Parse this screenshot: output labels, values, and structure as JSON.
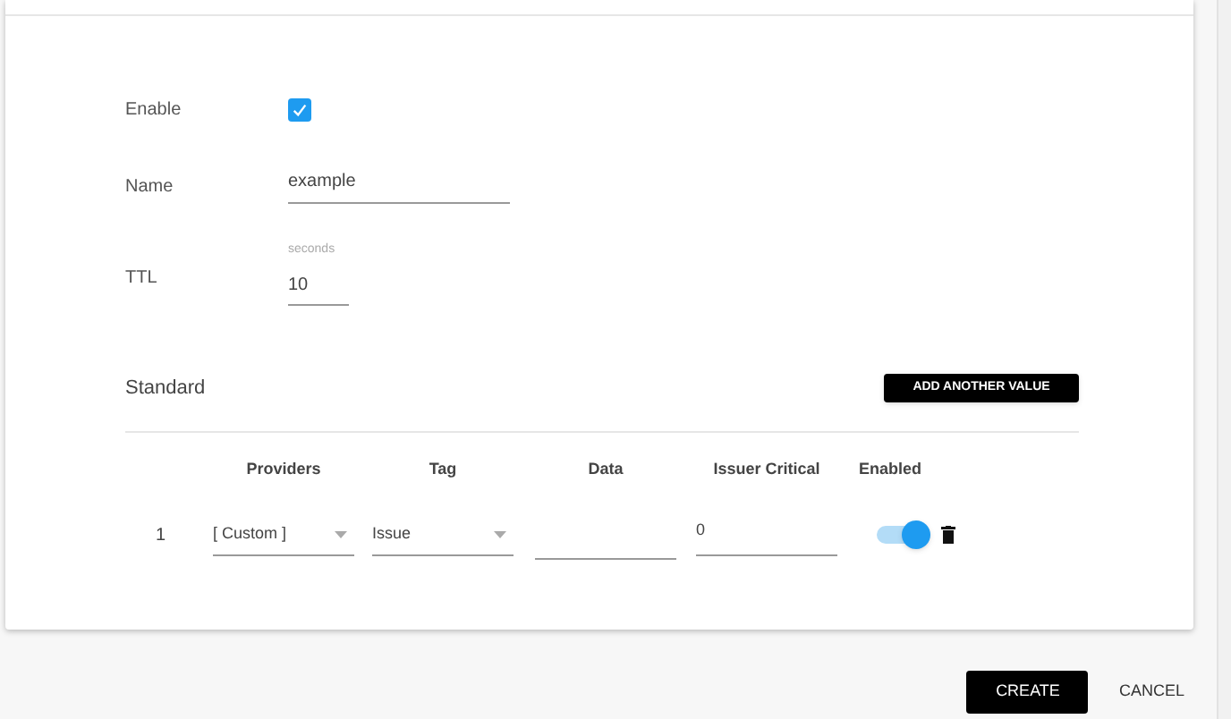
{
  "form": {
    "fields": [
      {
        "kind": "checkbox",
        "label": "Enable",
        "checked": true
      },
      {
        "kind": "text",
        "label": "Name",
        "value": "example"
      },
      {
        "kind": "number",
        "label": "TTL",
        "unit_label": "seconds",
        "value": "10"
      }
    ]
  },
  "standard": {
    "title": "Standard",
    "add_button": "ADD ANOTHER VALUE",
    "columns": [
      "Providers",
      "Tag",
      "Data",
      "Issuer Critical",
      "Enabled"
    ],
    "rows": [
      {
        "index": "1",
        "provider": "[ Custom ]",
        "tag": "Issue",
        "issuer_critical": "0",
        "enabled": true
      }
    ]
  },
  "actions": [
    {
      "kind": "primary",
      "label": "CREATE"
    },
    {
      "kind": "flat",
      "label": "CANCEL"
    }
  ]
}
